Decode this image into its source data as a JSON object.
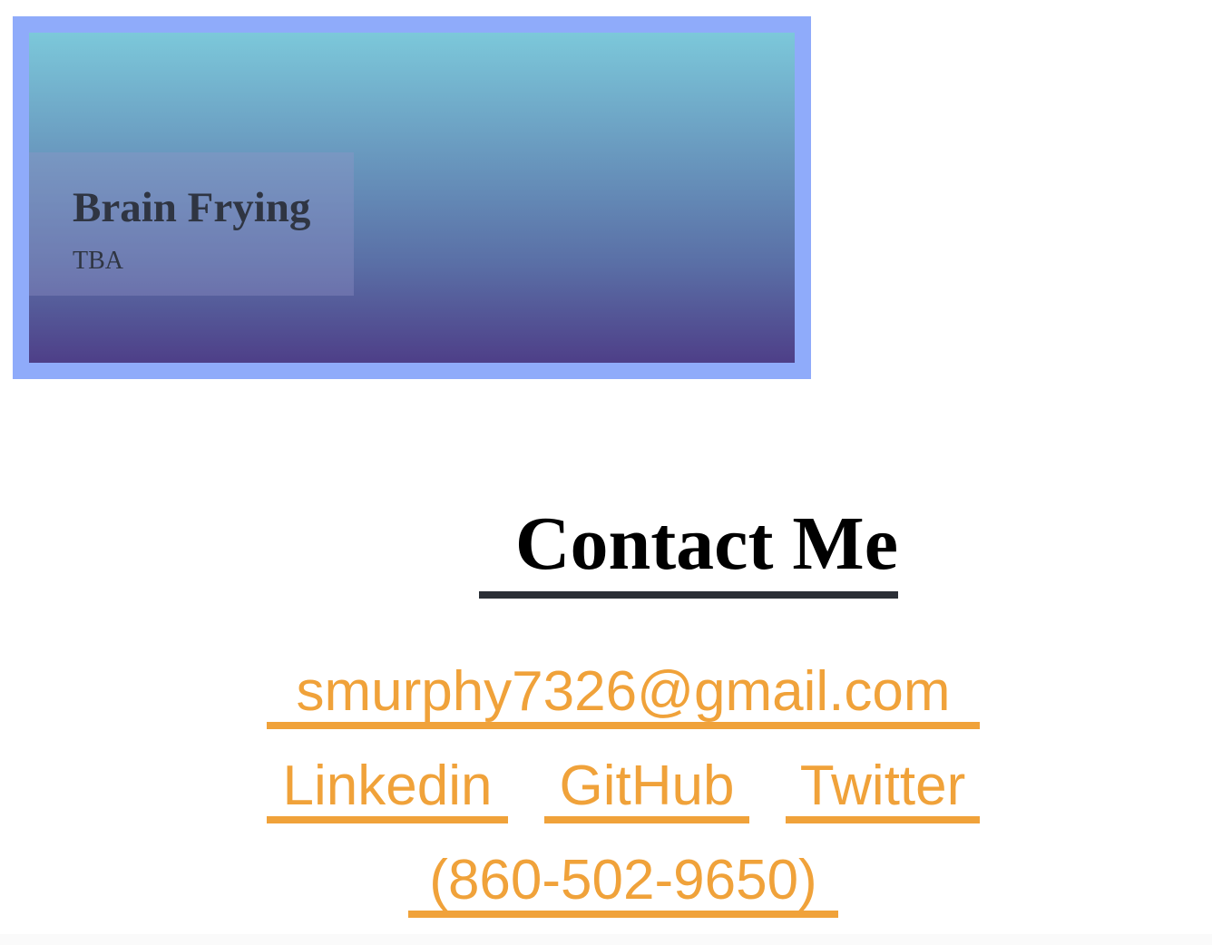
{
  "project": {
    "title": "Brain Frying",
    "subtitle": "TBA"
  },
  "contact": {
    "heading": "Contact Me",
    "email": "smurphy7326@gmail.com",
    "linkedin": "Linkedin",
    "github": "GitHub",
    "twitter": "Twitter",
    "phone": "(860-502-9650)"
  },
  "colors": {
    "card_border": "#8fabfa",
    "gradient_top": "#7cc8da",
    "gradient_bottom": "#4e3f88",
    "link": "#f0a23a",
    "heading_underline": "#2b2f36"
  }
}
